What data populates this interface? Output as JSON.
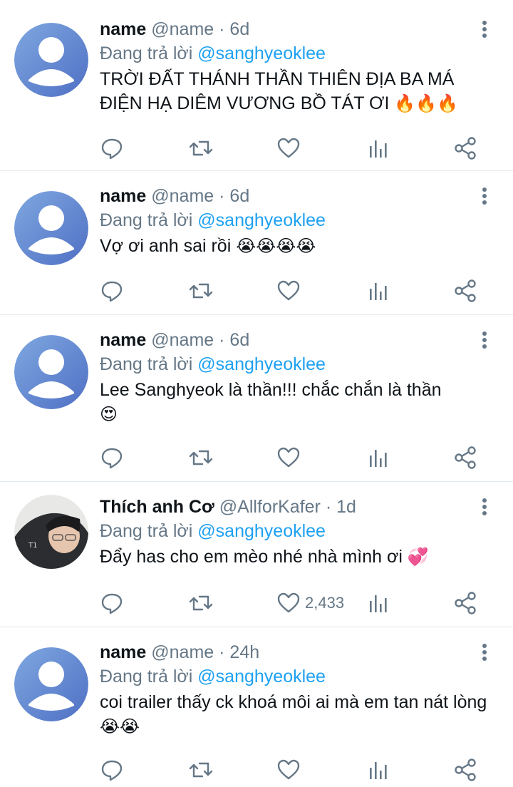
{
  "colors": {
    "link": "#1da1f2",
    "muted": "#657786",
    "text": "#0f1419",
    "divider": "#e1e8ed"
  },
  "tweets": [
    {
      "display_name": "name",
      "handle": "@name",
      "separator": "·",
      "time": "6d",
      "reply_prefix": "Đang trả lời",
      "reply_to": "@sanghyeoklee",
      "text": "TRỜI ĐẤT THÁNH THẦN THIÊN ĐỊA BA MÁ ĐIỆN HẠ DIÊM VƯƠNG BỒ TÁT ƠI",
      "emoji": "🔥🔥🔥",
      "like_count": ""
    },
    {
      "display_name": "name",
      "handle": "@name",
      "separator": "·",
      "time": "6d",
      "reply_prefix": "Đang trả lời",
      "reply_to": "@sanghyeoklee",
      "text": "Vợ ơi anh sai rồi",
      "emoji": "😭😭😭😭",
      "like_count": ""
    },
    {
      "display_name": "name",
      "handle": "@name",
      "separator": "·",
      "time": "6d",
      "reply_prefix": "Đang trả lời",
      "reply_to": "@sanghyeoklee",
      "text": "Lee Sanghyeok là thần!!! chắc chắn là thần",
      "emoji": "😍",
      "like_count": ""
    },
    {
      "display_name": "Thích anh Cơ",
      "handle": "@AllforKafer",
      "separator": "·",
      "time": "1d",
      "reply_prefix": "Đang trả lời",
      "reply_to": "@sanghyeoklee",
      "text": "Đẩy has cho em mèo nhé nhà mình ơi",
      "emoji": "💞",
      "like_count": "2,433"
    },
    {
      "display_name": "name",
      "handle": "@name",
      "separator": "·",
      "time": "24h",
      "reply_prefix": "Đang trả lời",
      "reply_to": "@sanghyeoklee",
      "text": "coi trailer thấy ck khoá môi ai mà em tan nát lòng",
      "emoji": "😭😭",
      "like_count": ""
    }
  ]
}
